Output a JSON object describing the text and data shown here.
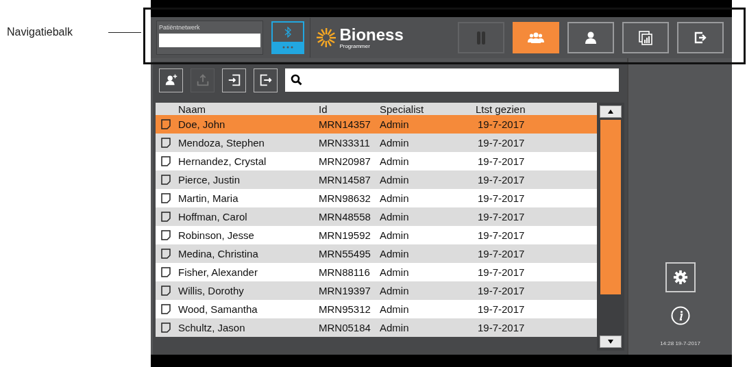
{
  "callout": {
    "label": "Navigatiebalk"
  },
  "navbar": {
    "network_field": {
      "label": "Patiëntnetwerk"
    },
    "bluetooth": {
      "selected": true
    },
    "logo": {
      "name": "Bioness",
      "subtitle": "Programmer"
    },
    "buttons": [
      {
        "kind": "legs",
        "selected": false,
        "disabled": true
      },
      {
        "kind": "patients",
        "selected": true,
        "disabled": false
      },
      {
        "kind": "patient",
        "selected": false,
        "disabled": false
      },
      {
        "kind": "reports",
        "selected": false,
        "disabled": false
      },
      {
        "kind": "exit",
        "selected": false,
        "disabled": false
      }
    ]
  },
  "toolbar": {
    "buttons": [
      {
        "kind": "add-patient",
        "disabled": false
      },
      {
        "kind": "upload",
        "disabled": true
      },
      {
        "kind": "import",
        "disabled": false
      },
      {
        "kind": "export",
        "disabled": false
      }
    ]
  },
  "table": {
    "columns": [
      "Naam",
      "Id",
      "Specialist",
      "Ltst gezien"
    ],
    "rows": [
      {
        "name": "Doe, John",
        "id": "MRN14357",
        "specialist": "Admin",
        "last_seen": "19-7-2017",
        "selected": true
      },
      {
        "name": "Mendoza, Stephen",
        "id": "MRN33311",
        "specialist": "Admin",
        "last_seen": "19-7-2017",
        "selected": false
      },
      {
        "name": "Hernandez, Crystal",
        "id": "MRN20987",
        "specialist": "Admin",
        "last_seen": "19-7-2017",
        "selected": false
      },
      {
        "name": "Pierce, Justin",
        "id": "MRN14587",
        "specialist": "Admin",
        "last_seen": "19-7-2017",
        "selected": false
      },
      {
        "name": "Martin, Maria",
        "id": "MRN98632",
        "specialist": "Admin",
        "last_seen": "19-7-2017",
        "selected": false
      },
      {
        "name": "Hoffman, Carol",
        "id": "MRN48558",
        "specialist": "Admin",
        "last_seen": "19-7-2017",
        "selected": false
      },
      {
        "name": "Robinson, Jesse",
        "id": "MRN19592",
        "specialist": "Admin",
        "last_seen": "19-7-2017",
        "selected": false
      },
      {
        "name": "Medina, Christina",
        "id": "MRN55495",
        "specialist": "Admin",
        "last_seen": "19-7-2017",
        "selected": false
      },
      {
        "name": "Fisher, Alexander",
        "id": "MRN88116",
        "specialist": "Admin",
        "last_seen": "19-7-2017",
        "selected": false
      },
      {
        "name": "Willis, Dorothy",
        "id": "MRN19397",
        "specialist": "Admin",
        "last_seen": "19-7-2017",
        "selected": false
      },
      {
        "name": "Wood, Samantha",
        "id": "MRN95312",
        "specialist": "Admin",
        "last_seen": "19-7-2017",
        "selected": false
      },
      {
        "name": "Schultz, Jason",
        "id": "MRN05184",
        "specialist": "Admin",
        "last_seen": "19-7-2017",
        "selected": false
      }
    ]
  },
  "sidebar": {
    "timestamp": "14:28 19-7-2017"
  }
}
